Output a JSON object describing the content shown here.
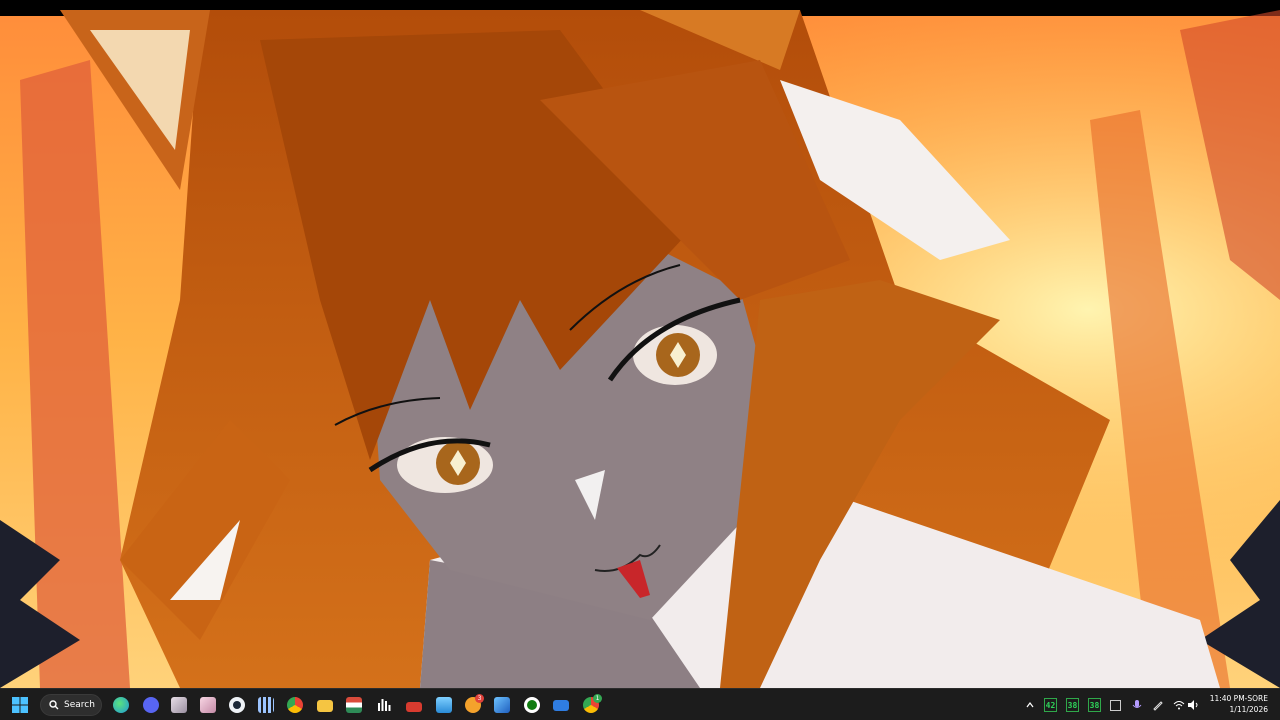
{
  "taskbar": {
    "search_label": "Search",
    "pinned": [
      {
        "name": "edge",
        "color": "#1f9ad6"
      },
      {
        "name": "discord",
        "color": "#5865f2"
      },
      {
        "name": "app-anime",
        "color": "#c9b9c9"
      },
      {
        "name": "app-anime-2",
        "color": "#e7c4d2"
      },
      {
        "name": "steam",
        "color": "#1b2838"
      },
      {
        "name": "app-grid",
        "color": "#6fa8ff"
      },
      {
        "name": "chrome-beta",
        "color": "#34a853"
      },
      {
        "name": "file-explorer",
        "color": "#f5c542"
      },
      {
        "name": "app-flag",
        "color": "#d94b3b"
      },
      {
        "name": "audio-bars",
        "color": "#ffffff"
      },
      {
        "name": "app-red",
        "color": "#d83b2f"
      },
      {
        "name": "app-photos",
        "color": "#3fa6e8"
      },
      {
        "name": "app-chat",
        "color": "#f4a22c"
      },
      {
        "name": "app-blue",
        "color": "#2c7be5"
      },
      {
        "name": "xbox",
        "color": "#ffffff"
      },
      {
        "name": "remote-desktop",
        "color": "#2f7de1"
      },
      {
        "name": "chrome",
        "color": "#fbbc05"
      }
    ],
    "chat_badge": "3",
    "chrome_badge": "1"
  },
  "tray": {
    "counters": [
      "42",
      "38",
      "38"
    ],
    "time": "11:40 PM-SORE",
    "date": "1/11/2026"
  },
  "colors": {
    "taskbar_bg": "#1c1c1c",
    "counter_green": "#2fd35a"
  }
}
